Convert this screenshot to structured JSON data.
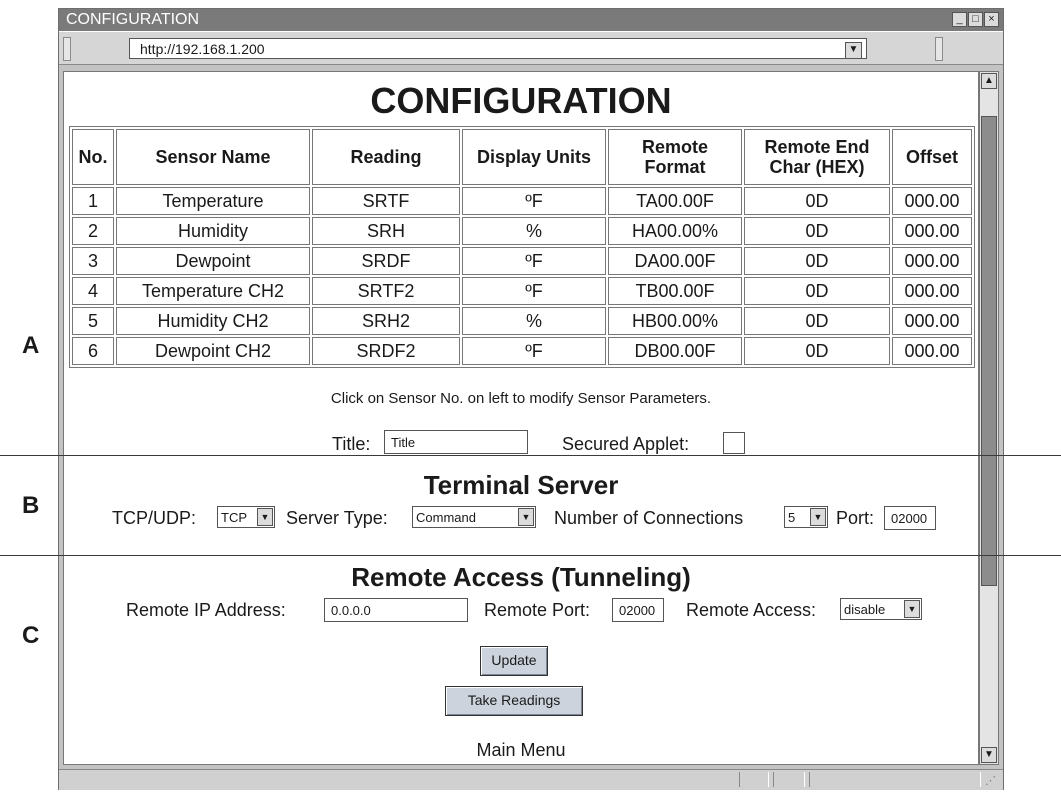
{
  "side_labels": [
    "A",
    "B",
    "C"
  ],
  "window": {
    "title": "CONFIGURATION",
    "url": "http://192.168.1.200"
  },
  "page": {
    "heading": "CONFIGURATION",
    "table": {
      "headers": [
        "No.",
        "Sensor Name",
        "Reading",
        "Display Units",
        "Remote Format",
        "Remote End Char (HEX)",
        "Offset"
      ],
      "rows": [
        [
          "1",
          "Temperature",
          "SRTF",
          "ºF",
          "TA00.00F",
          "0D",
          "000.00"
        ],
        [
          "2",
          "Humidity",
          "SRH",
          "%",
          "HA00.00%",
          "0D",
          "000.00"
        ],
        [
          "3",
          "Dewpoint",
          "SRDF",
          "ºF",
          "DA00.00F",
          "0D",
          "000.00"
        ],
        [
          "4",
          "Temperature CH2",
          "SRTF2",
          "ºF",
          "TB00.00F",
          "0D",
          "000.00"
        ],
        [
          "5",
          "Humidity CH2",
          "SRH2",
          "%",
          "HB00.00%",
          "0D",
          "000.00"
        ],
        [
          "6",
          "Dewpoint CH2",
          "SRDF2",
          "ºF",
          "DB00.00F",
          "0D",
          "000.00"
        ]
      ]
    },
    "hint": "Click on Sensor No. on left to modify Sensor Parameters.",
    "title_label": "Title:",
    "title_value": "Title",
    "secured_label": "Secured Applet:",
    "terminal": {
      "heading": "Terminal Server",
      "tcp_label": "TCP/UDP:",
      "tcp_value": "TCP",
      "server_type_label": "Server Type:",
      "server_type_value": "Command",
      "connections_label": "Number of Connections",
      "connections_value": "5",
      "port_label": "Port:",
      "port_value": "02000"
    },
    "remote": {
      "heading": "Remote Access (Tunneling)",
      "ip_label": "Remote IP Address:",
      "ip_value": "0.0.0.0",
      "port_label": "Remote Port:",
      "port_value": "02000",
      "access_label": "Remote Access:",
      "access_value": "disable"
    },
    "update_button": "Update",
    "take_readings_button": "Take Readings",
    "main_menu": "Main Menu"
  },
  "colors": {
    "titlebar": "#7a7a7a",
    "button": "#cdd3dd",
    "scroll_thumb": "#8c8c8c"
  }
}
